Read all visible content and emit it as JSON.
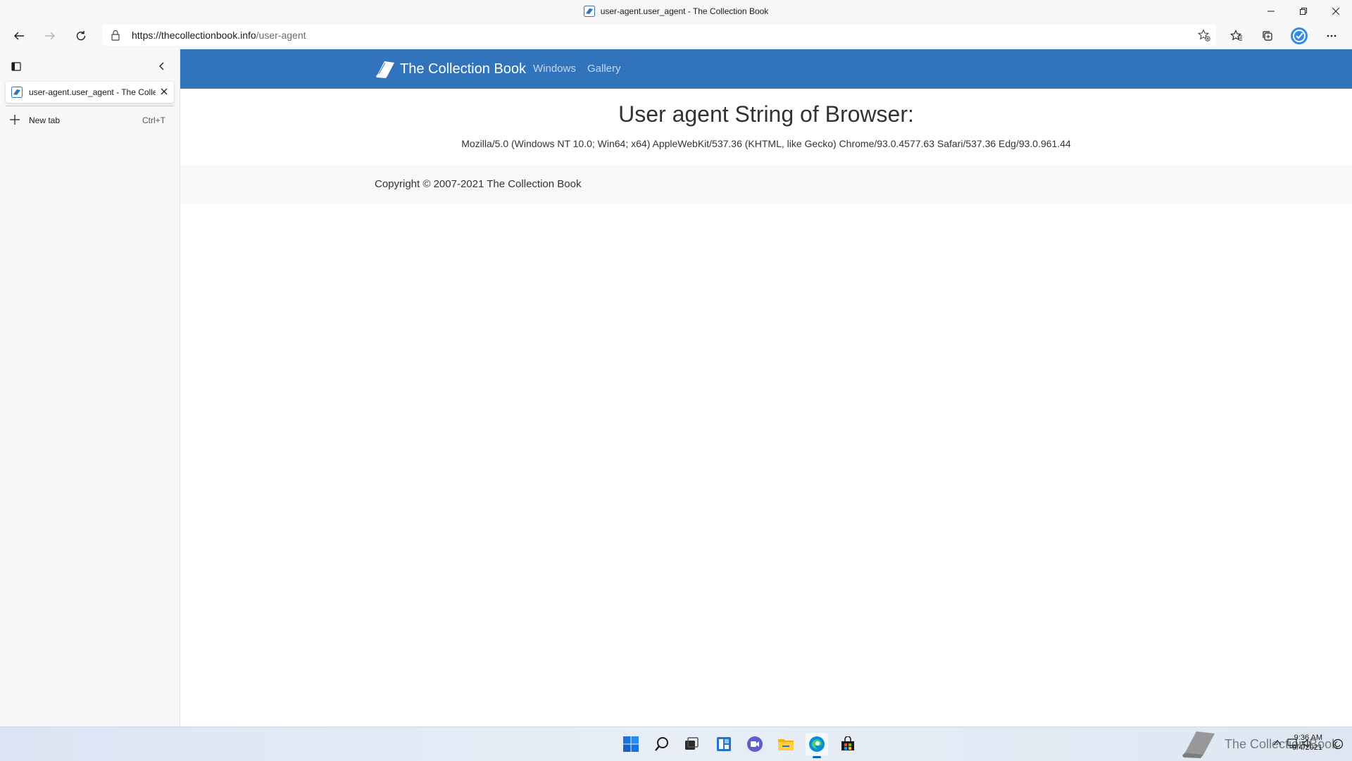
{
  "window": {
    "title": "user-agent.user_agent - The Collection Book"
  },
  "toolbar": {
    "url_host": "https://thecollectionbook.info",
    "url_path": "/user-agent"
  },
  "sidebar": {
    "tabs": [
      {
        "label": "user-agent.user_agent - The Collection Book"
      }
    ],
    "new_tab_label": "New tab",
    "new_tab_shortcut": "Ctrl+T"
  },
  "site": {
    "brand": "The Collection Book",
    "nav": [
      "Windows",
      "Gallery"
    ],
    "heading": "User agent String of Browser:",
    "user_agent": "Mozilla/5.0 (Windows NT 10.0; Win64; x64) AppleWebKit/537.36 (KHTML, like Gecko) Chrome/93.0.4577.63 Safari/537.36 Edg/93.0.961.44",
    "copyright": "Copyright © 2007-2021 The Collection Book"
  },
  "taskbar": {
    "icons": [
      "windows-start-icon",
      "search-icon",
      "task-view-icon",
      "widgets-icon",
      "chat-icon",
      "file-explorer-icon",
      "edge-icon",
      "store-icon"
    ],
    "watermark": "The Collection Book",
    "time": "9:36 AM",
    "date": "9/4/2021"
  },
  "colors": {
    "navbar": "#3174bc",
    "nav_link": "#c6d8ef",
    "chrome_bg": "#f7f7f7",
    "footer_bg": "#f7f8f9"
  }
}
